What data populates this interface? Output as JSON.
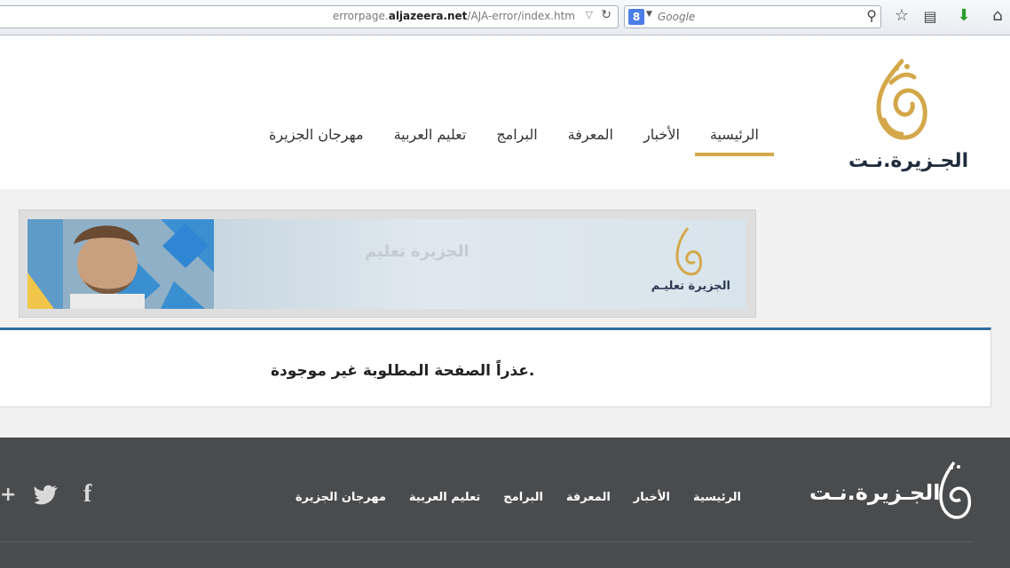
{
  "browser": {
    "url_prefix": "errorpage.",
    "url_domain": "aljazeera.net",
    "url_path": "/AJA-error/index.htm",
    "search_engine_letter": "8",
    "search_placeholder": "Google",
    "icons": [
      "url-dropdown-icon",
      "reload-icon",
      "search-engine-icon",
      "search-go-icon",
      "bookmark-star-icon",
      "reading-list-icon",
      "download-icon",
      "home-icon"
    ]
  },
  "header": {
    "logo_text": "الجـزيرة.نـت",
    "nav": [
      {
        "label": "الرئيسية",
        "active": true
      },
      {
        "label": "الأخبار",
        "active": false
      },
      {
        "label": "المعرفة",
        "active": false
      },
      {
        "label": "البرامج",
        "active": false
      },
      {
        "label": "تعليم العربية",
        "active": false
      },
      {
        "label": "مهرجان الجزيرة",
        "active": false
      }
    ],
    "accent_color": "#d4a84a"
  },
  "banner": {
    "watermark_text": "الجزيرة تعليم",
    "brand_text": "الجزيرة تعليـم"
  },
  "error": {
    "message": "عذراً الصفحة المطلوبة غير موجودة."
  },
  "footer": {
    "logo_text": "الجـزيرة.نـت",
    "nav": [
      "الرئيسية",
      "الأخبار",
      "المعرفة",
      "البرامج",
      "تعليم العربية",
      "مهرجان الجزيرة"
    ],
    "social": {
      "facebook": "f",
      "twitter": "twitter-icon",
      "googleplus": "+"
    },
    "background": "#4a4b4d"
  }
}
